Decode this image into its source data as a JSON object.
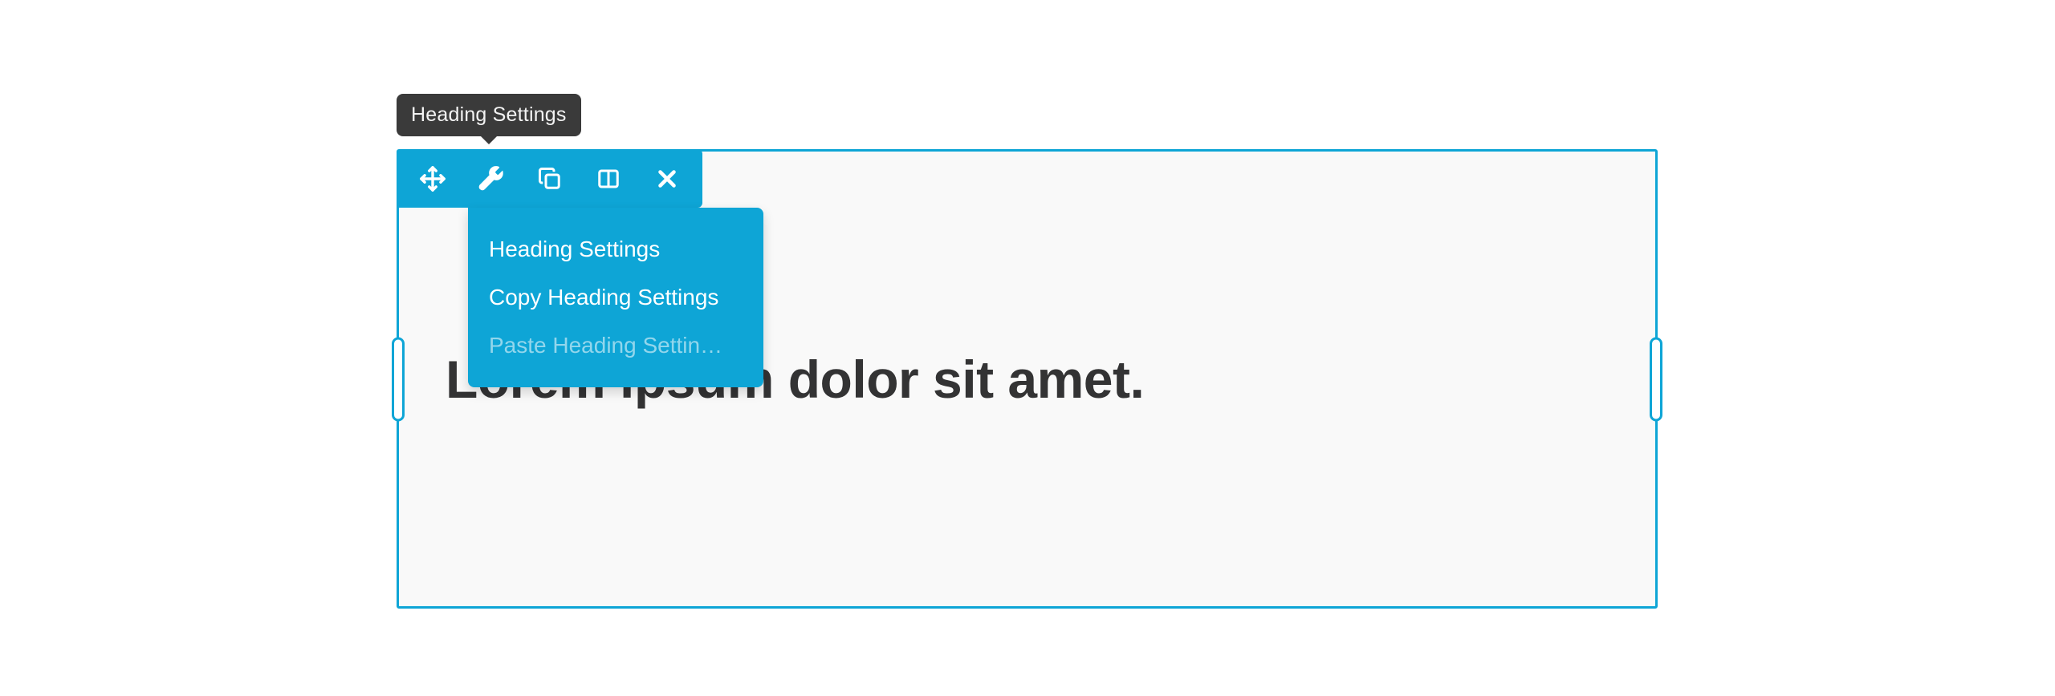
{
  "tooltip": {
    "text": "Heading Settings"
  },
  "toolbar": {
    "icons": [
      "move",
      "wrench",
      "copy",
      "columns",
      "close"
    ]
  },
  "dropdown": {
    "items": [
      {
        "label": "Heading Settings",
        "disabled": false
      },
      {
        "label": "Copy Heading Settings",
        "disabled": false
      },
      {
        "label": "Paste Heading Settin…",
        "disabled": true
      }
    ]
  },
  "content": {
    "heading": "Lorem ipsum dolor sit amet."
  },
  "colors": {
    "accent": "#0ea5d6",
    "tooltip_bg": "#3a3a3a"
  }
}
